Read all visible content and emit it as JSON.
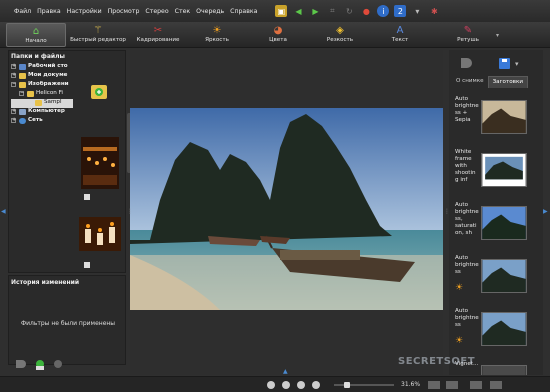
{
  "menu": {
    "items": [
      "Файл",
      "Правка",
      "Настройки",
      "Просмотр",
      "Стерео",
      "Стек",
      "Очередь",
      "Справка"
    ]
  },
  "toolbar": {
    "badge": "2"
  },
  "ribbon": {
    "tabs": [
      "Начало",
      "Быстрый редактор",
      "Кадрирование",
      "Яркость",
      "Цвета",
      "Резкость",
      "Текст",
      "Ретушь"
    ]
  },
  "left": {
    "title": "Папки и файлы",
    "tree": [
      "Рабочий сто",
      "Мои докуме",
      "Изображени",
      "Helicon Fi",
      "Sampl",
      "Компьютер",
      "Сеть"
    ]
  },
  "history": {
    "title": "История изменений",
    "empty_text": "Фильтры не были применены"
  },
  "right": {
    "tabs": [
      "О снимке",
      "Заготовки"
    ],
    "presets": [
      "Auto brightness + Sepia",
      "White frame with shooting inf",
      "Auto brightness, saturation, sh",
      "Auto brightness",
      "Auto brightness",
      "Vignet..."
    ]
  },
  "status": {
    "zoom": "31.6%"
  },
  "watermark": "SECRETSOFT"
}
